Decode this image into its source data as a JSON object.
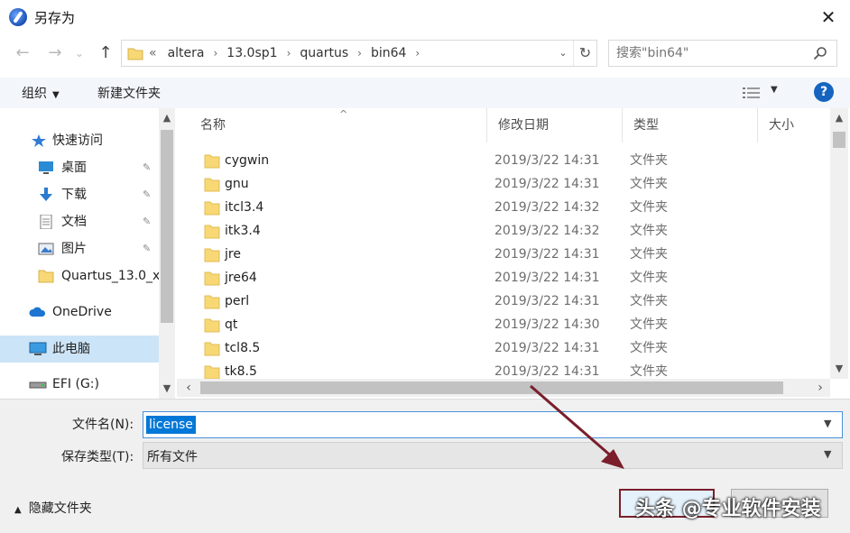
{
  "window": {
    "title": "另存为",
    "close_glyph": "✕"
  },
  "nav": {
    "back_glyph": "←",
    "forward_glyph": "→",
    "recent_glyph": "⌄",
    "up_glyph": "↑"
  },
  "address": {
    "lead": "«",
    "crumbs": [
      "altera",
      "13.0sp1",
      "quartus",
      "bin64"
    ],
    "sep": "›",
    "dropdown_glyph": "⌄",
    "refresh_glyph": "↻"
  },
  "search": {
    "placeholder": "搜索\"bin64\""
  },
  "toolbar": {
    "organize": "组织",
    "new_folder": "新建文件夹",
    "help": "?"
  },
  "navpane": {
    "items": [
      {
        "label": "快速访问",
        "icon": "star-icon",
        "pinned": false
      },
      {
        "label": "桌面",
        "icon": "desktop-icon",
        "pinned": true
      },
      {
        "label": "下载",
        "icon": "download-icon",
        "pinned": true
      },
      {
        "label": "文档",
        "icon": "document-icon",
        "pinned": true
      },
      {
        "label": "图片",
        "icon": "picture-icon",
        "pinned": true
      },
      {
        "label": "Quartus_13.0_x",
        "icon": "folder-icon",
        "pinned": false
      },
      {
        "label": "OneDrive",
        "icon": "cloud-icon",
        "pinned": false
      },
      {
        "label": "此电脑",
        "icon": "computer-icon",
        "pinned": false
      },
      {
        "label": "EFI (G:)",
        "icon": "drive-icon",
        "pinned": false
      }
    ],
    "pin_glyph": "📌"
  },
  "filelist": {
    "columns": [
      "名称",
      "修改日期",
      "类型",
      "大小"
    ],
    "sort_glyph": "^",
    "rows": [
      {
        "name": "cygwin",
        "date": "2019/3/22 14:31",
        "type": "文件夹"
      },
      {
        "name": "gnu",
        "date": "2019/3/22 14:31",
        "type": "文件夹"
      },
      {
        "name": "itcl3.4",
        "date": "2019/3/22 14:32",
        "type": "文件夹"
      },
      {
        "name": "itk3.4",
        "date": "2019/3/22 14:32",
        "type": "文件夹"
      },
      {
        "name": "jre",
        "date": "2019/3/22 14:31",
        "type": "文件夹"
      },
      {
        "name": "jre64",
        "date": "2019/3/22 14:31",
        "type": "文件夹"
      },
      {
        "name": "perl",
        "date": "2019/3/22 14:31",
        "type": "文件夹"
      },
      {
        "name": "qt",
        "date": "2019/3/22 14:30",
        "type": "文件夹"
      },
      {
        "name": "tcl8.5",
        "date": "2019/3/22 14:31",
        "type": "文件夹"
      },
      {
        "name": "tk8.5",
        "date": "2019/3/22 14:31",
        "type": "文件夹"
      }
    ]
  },
  "form": {
    "filename_label": "文件名(N):",
    "filename_value": "license",
    "filetype_label": "保存类型(T):",
    "filetype_value": "所有文件",
    "hide_folders": "隐藏文件夹",
    "save": "",
    "cancel": ""
  },
  "watermark": "头条 @专业软件安装",
  "colors": {
    "accent": "#0078d7",
    "toolbar_bg": "#f3f6fb",
    "selected_bg": "#cce4f7",
    "folder": "#f8d775"
  }
}
